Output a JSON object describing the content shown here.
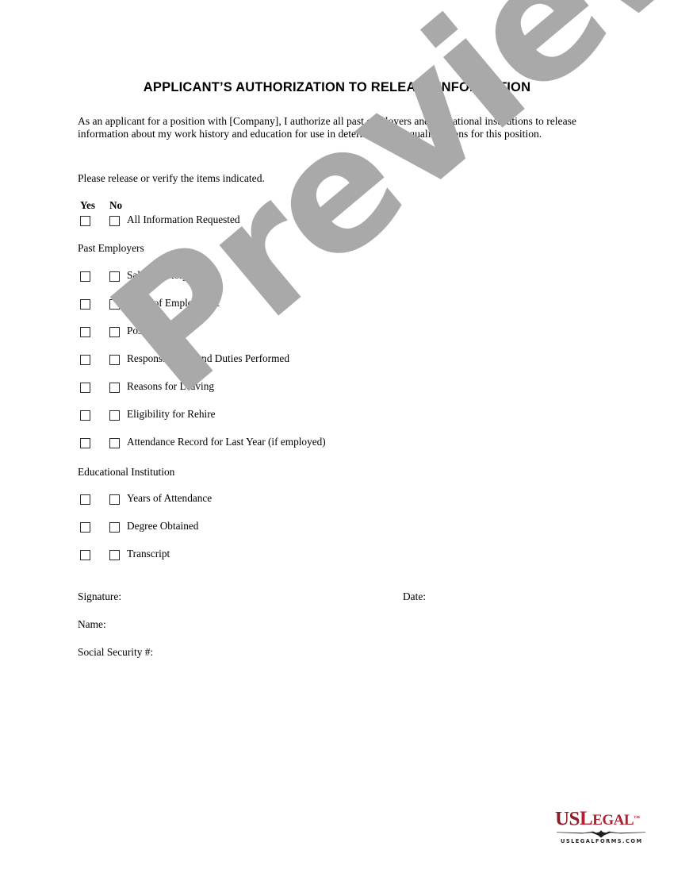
{
  "document": {
    "title": "APPLICANT’S AUTHORIZATION TO RELEASE INFORMATION",
    "intro_paragraph": "As an applicant for a position with [Company], I authorize all past employers and educational institutions to release information about my work history and education for use in determining my qualifications for this position.",
    "instruction": "Please release or verify the items indicated."
  },
  "columns": {
    "yes_label": "Yes",
    "no_label": "No"
  },
  "items": {
    "all_information": "All Information Requested",
    "past_employers_heading": "Past Employers",
    "salary_history": "Salary History",
    "dates_of_employment": "Dates of Employment",
    "positions_held": "Positions Held",
    "responsibilities": "Responsibilities and Duties Performed",
    "reasons_for_leaving": "Reasons for Leaving",
    "eligibility_for_rehire": "Eligibility for Rehire",
    "attendance_record": "Attendance Record for Last Year (if employed)",
    "educational_institution_heading": "Educational Institution",
    "years_of_attendance": "Years of Attendance",
    "degree_obtained": "Degree Obtained",
    "transcript": "Transcript"
  },
  "signature_block": {
    "signature_label": "Signature:",
    "date_label": "Date:",
    "name_label": "Name:",
    "ssn_label": "Social Security #:"
  },
  "watermark": {
    "text": "Preview",
    "color": "#a9a9a9"
  },
  "logo": {
    "us_text": "US",
    "legal_text_cap": "L",
    "legal_text_rest": "EGAL",
    "trademark": "™",
    "tagline": "USLEGALFORMS.COM",
    "color_us": "#8f1d2a",
    "color_legal": "#b12030",
    "color_tagline": "#231f20"
  }
}
